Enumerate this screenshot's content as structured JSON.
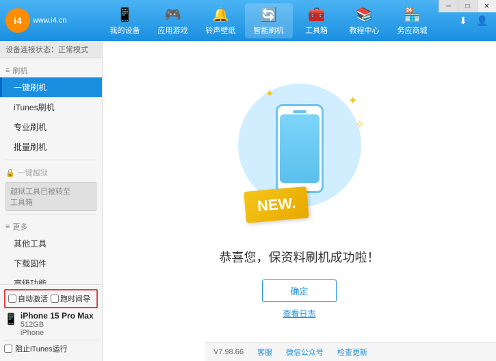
{
  "titleBar": {
    "minimize": "─",
    "maximize": "□",
    "close": "✕"
  },
  "header": {
    "logo": {
      "symbol": "i4",
      "site": "www.i4.cn"
    },
    "nav": [
      {
        "id": "my-device",
        "icon": "📱",
        "label": "我的设备"
      },
      {
        "id": "apps-games",
        "icon": "👤",
        "label": "应用游戏"
      },
      {
        "id": "ringtone",
        "icon": "🔔",
        "label": "铃声壁纸"
      },
      {
        "id": "smart-flash",
        "icon": "🔄",
        "label": "智能刷机",
        "active": true
      },
      {
        "id": "toolbox",
        "icon": "💼",
        "label": "工具箱"
      },
      {
        "id": "tutorial",
        "icon": "🎓",
        "label": "教程中心"
      },
      {
        "id": "service",
        "icon": "🖥️",
        "label": "务应商城"
      }
    ],
    "rightIcons": [
      {
        "id": "download",
        "icon": "⬇"
      },
      {
        "id": "user",
        "icon": "👤"
      }
    ]
  },
  "breadcrumb": {
    "text": "设备连接状态：正常模式"
  },
  "sidebar": {
    "sections": [
      {
        "title": "刷机",
        "icon": "≡",
        "items": [
          {
            "id": "one-key-flash",
            "label": "一键刷机",
            "active": true
          },
          {
            "id": "itunes-flash",
            "label": "iTunes刷机"
          },
          {
            "id": "pro-flash",
            "label": "专业刷机"
          },
          {
            "id": "batch-flash",
            "label": "批量刷机"
          }
        ]
      },
      {
        "title": "一键越狱",
        "icon": "🔒",
        "disabled": true,
        "disabledNote": "越狱工具已被转至\n工具箱"
      },
      {
        "title": "更多",
        "icon": "≡",
        "items": [
          {
            "id": "other-tools",
            "label": "其他工具"
          },
          {
            "id": "download-firmware",
            "label": "下载固件"
          },
          {
            "id": "advanced",
            "label": "高级功能"
          }
        ]
      }
    ],
    "bottomSection": {
      "autoActivate": "自动激活",
      "timeGuide": "跑时间导",
      "device": {
        "name": "iPhone 15 Pro Max",
        "storage": "512GB",
        "type": "iPhone"
      },
      "itunesLabel": "阻止iTunes运行"
    }
  },
  "content": {
    "newBadge": "NEW.",
    "successMsg": "恭喜您，保资料刷机成功啦！",
    "confirmBtn": "确定",
    "logLink": "查看日志"
  },
  "footer": {
    "version": "V7.98.66",
    "links": [
      {
        "id": "client",
        "label": "客服"
      },
      {
        "id": "wechat",
        "label": "微信公众号"
      },
      {
        "id": "check-update",
        "label": "检查更新"
      }
    ]
  }
}
